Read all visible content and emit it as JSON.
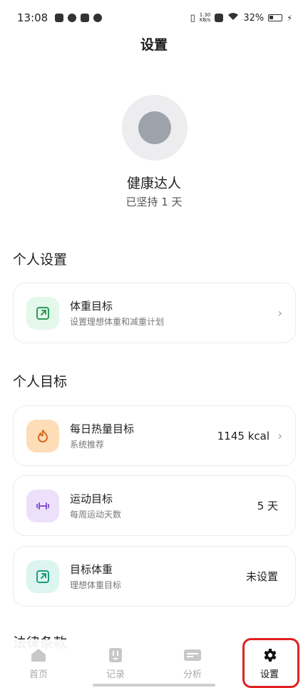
{
  "status_bar": {
    "time": "13:08",
    "speed_top": "1.30",
    "speed_bottom": "KB/s",
    "battery": "32%"
  },
  "header": {
    "title": "设置"
  },
  "profile": {
    "name": "健康达人",
    "streak": "已坚持 1 天"
  },
  "sections": {
    "personal_settings": "个人设置",
    "personal_goals": "个人目标",
    "legal": "法律条款"
  },
  "cards": {
    "weight_goal": {
      "title": "体重目标",
      "subtitle": "设置理想体重和减重计划",
      "icon": "external-link-icon",
      "color": "#e3f7ea"
    },
    "calorie_goal": {
      "title": "每日热量目标",
      "subtitle": "系统推荐",
      "value": "1145 kcal",
      "icon": "flame-icon",
      "color": "#fdddb8"
    },
    "exercise_goal": {
      "title": "运动目标",
      "subtitle": "每周运动天数",
      "value": "5 天",
      "icon": "dumbbell-icon",
      "color": "#ece0fb"
    },
    "target_weight": {
      "title": "目标体重",
      "subtitle": "理想体重目标",
      "value": "未设置",
      "icon": "external-link-icon",
      "color": "#dcf6ef"
    }
  },
  "tabbar": {
    "home": "首页",
    "records": "记录",
    "analysis": "分析",
    "settings": "设置",
    "active": "settings",
    "highlight_color": "#e02020"
  }
}
